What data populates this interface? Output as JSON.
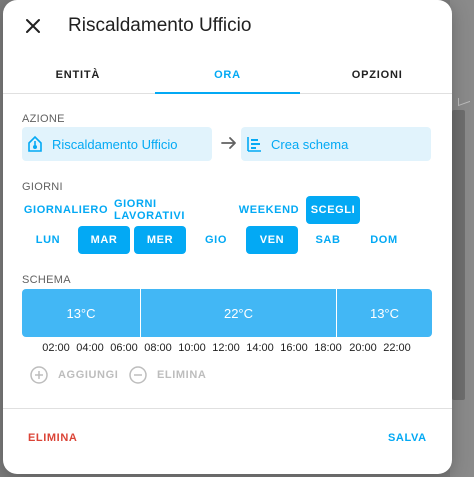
{
  "dialog": {
    "title": "Riscaldamento Ufficio",
    "close_icon": "close-icon"
  },
  "tabs": [
    {
      "label": "ENTITÀ",
      "active": false
    },
    {
      "label": "ORA",
      "active": true
    },
    {
      "label": "OPZIONI",
      "active": false
    }
  ],
  "azione": {
    "label": "AZIONE",
    "entity": {
      "text": "Riscaldamento Ufficio",
      "icon": "thermostat-icon"
    },
    "arrow_icon": "arrow-right-icon",
    "service": {
      "text": "Crea schema",
      "icon": "calendar-schedule-icon"
    }
  },
  "giorni": {
    "label": "GIORNI",
    "presets": [
      {
        "label": "GIORNALIERO",
        "selected": false
      },
      {
        "label": "GIORNI LAVORATIVI",
        "selected": false
      },
      {
        "label": "WEEKEND",
        "selected": false
      },
      {
        "label": "SCEGLI",
        "selected": true
      }
    ],
    "days": [
      {
        "label": "LUN",
        "selected": false
      },
      {
        "label": "MAR",
        "selected": true
      },
      {
        "label": "MER",
        "selected": true
      },
      {
        "label": "GIO",
        "selected": false
      },
      {
        "label": "VEN",
        "selected": true
      },
      {
        "label": "SAB",
        "selected": false
      },
      {
        "label": "DOM",
        "selected": false
      }
    ]
  },
  "schema": {
    "label": "SCHEMA",
    "slots": [
      {
        "value": "13°C",
        "start": "00:00",
        "end": "06:00"
      },
      {
        "value": "22°C",
        "start": "06:00",
        "end": "19:00"
      },
      {
        "value": "13°C",
        "start": "19:00",
        "end": "24:00"
      }
    ],
    "time_labels": [
      "02:00",
      "04:00",
      "06:00",
      "08:00",
      "10:00",
      "12:00",
      "14:00",
      "16:00",
      "18:00",
      "20:00",
      "22:00"
    ],
    "add_label": "AGGIUNGI",
    "remove_label": "ELIMINA"
  },
  "footer": {
    "delete_label": "ELIMINA",
    "save_label": "SALVA"
  },
  "colors": {
    "accent": "#03a9f4",
    "slot": "#42b7f5",
    "danger": "#db4437",
    "disabled": "#bdbdbd"
  }
}
